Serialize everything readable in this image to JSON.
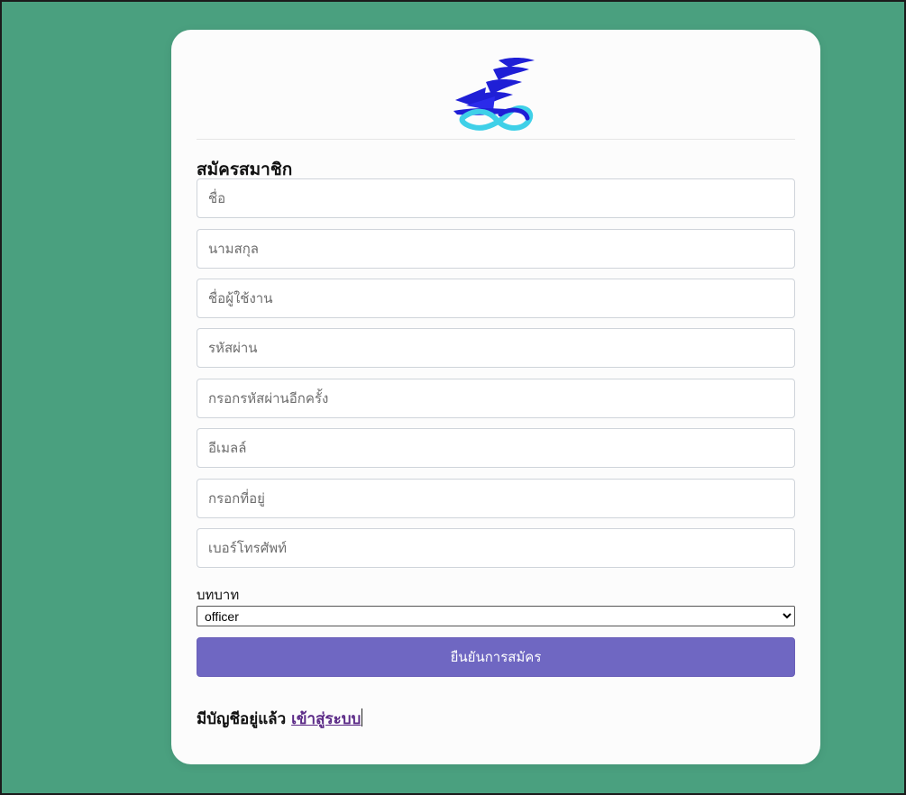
{
  "form": {
    "title": "สมัครสมาชิก",
    "fields": [
      {
        "name": "first-name-input",
        "placeholder": "ชื่อ"
      },
      {
        "name": "last-name-input",
        "placeholder": "นามสกุล"
      },
      {
        "name": "username-input",
        "placeholder": "ชื่อผู้ใช้งาน"
      },
      {
        "name": "password-input",
        "placeholder": "รหัสผ่าน"
      },
      {
        "name": "confirm-password-input",
        "placeholder": "กรอกรหัสผ่านอีกครั้ง"
      },
      {
        "name": "email-input",
        "placeholder": "อีเมลล์"
      },
      {
        "name": "address-input",
        "placeholder": "กรอกที่อยู่"
      },
      {
        "name": "phone-input",
        "placeholder": "เบอร์โทรศัพท์"
      }
    ],
    "role_label": "บทบาท",
    "role_selected": "officer",
    "submit_label": "ยืนยันการสมัคร"
  },
  "footer": {
    "prompt": "มีบัญชีอยู่แล้ว",
    "login_link": "เข้าสู่ระบบ"
  },
  "logo": {
    "icon": "ship-logo-icon",
    "primary_color": "#1f1fd6",
    "wave_color": "#3fd0e8"
  },
  "colors": {
    "background": "#4aa07f",
    "card": "#fcfcfc",
    "button": "#6f67c2",
    "link": "#5b2a87"
  }
}
